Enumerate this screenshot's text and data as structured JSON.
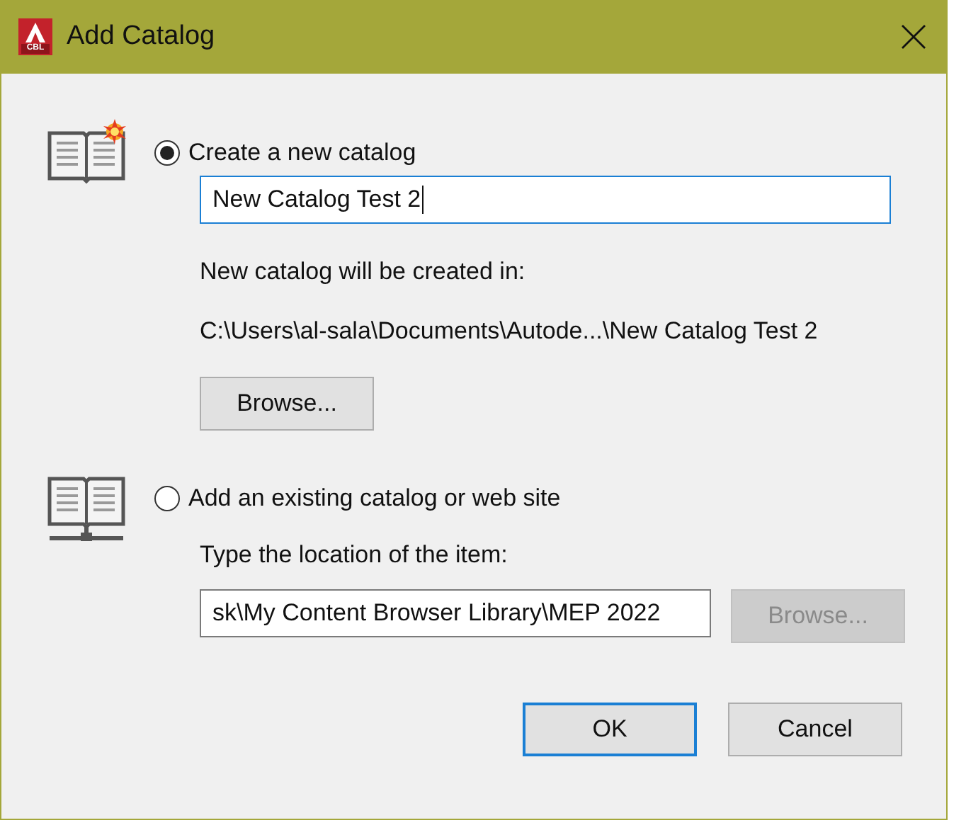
{
  "window": {
    "title": "Add Catalog",
    "app_icon_text": "CBL"
  },
  "options": [
    {
      "kind": "create",
      "label": "Create a new catalog",
      "selected": true,
      "name_value": "New Catalog Test 2",
      "info_label": "New catalog will be created in:",
      "path": "C:\\Users\\al-sala\\Documents\\Autode...\\New Catalog Test 2",
      "browse": {
        "label": "Browse...",
        "disabled": false
      }
    },
    {
      "kind": "existing",
      "label": "Add an existing catalog or web site",
      "selected": false,
      "info_label": "Type the location of the item:",
      "location_value": "sk\\My Content Browser Library\\MEP 2022",
      "browse": {
        "label": "Browse...",
        "disabled": true
      }
    }
  ],
  "buttons": [
    {
      "label": "OK",
      "default": true
    },
    {
      "label": "Cancel",
      "default": false
    }
  ]
}
